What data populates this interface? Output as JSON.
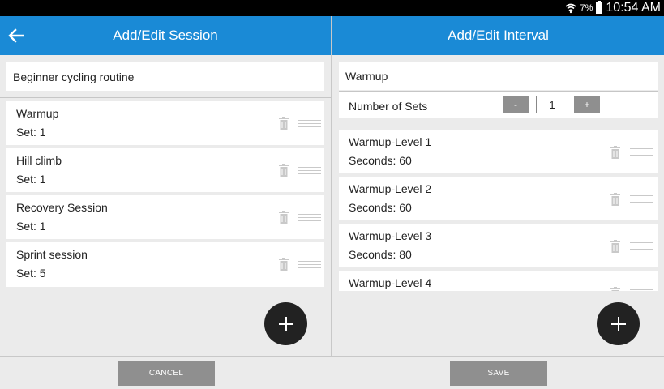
{
  "status_bar": {
    "battery_percent": "7%",
    "time": "10:54 AM",
    "icons": [
      "wifi-icon",
      "battery-icon"
    ]
  },
  "session_pane": {
    "title": "Add/Edit Session",
    "name": "Beginner cycling routine",
    "items": [
      {
        "name": "Warmup",
        "detail": "Set: 1"
      },
      {
        "name": "Hill climb",
        "detail": "Set: 1"
      },
      {
        "name": "Recovery Session",
        "detail": "Set: 1"
      },
      {
        "name": "Sprint session",
        "detail": "Set: 5"
      }
    ]
  },
  "interval_pane": {
    "title": "Add/Edit Interval",
    "name": "Warmup",
    "sets_label": "Number of Sets",
    "decrement_label": "-",
    "sets_value": "1",
    "increment_label": "+",
    "items": [
      {
        "name": "Warmup-Level 1",
        "detail": "Seconds: 60"
      },
      {
        "name": "Warmup-Level 2",
        "detail": "Seconds: 60"
      },
      {
        "name": "Warmup-Level 3",
        "detail": "Seconds: 80"
      },
      {
        "name": "Warmup-Level 4",
        "detail": ""
      }
    ]
  },
  "footer": {
    "cancel_label": "CANCEL",
    "save_label": "SAVE"
  },
  "colors": {
    "app_bar": "#1a8ad6",
    "fab": "#222222",
    "button": "#8f8f8f"
  }
}
